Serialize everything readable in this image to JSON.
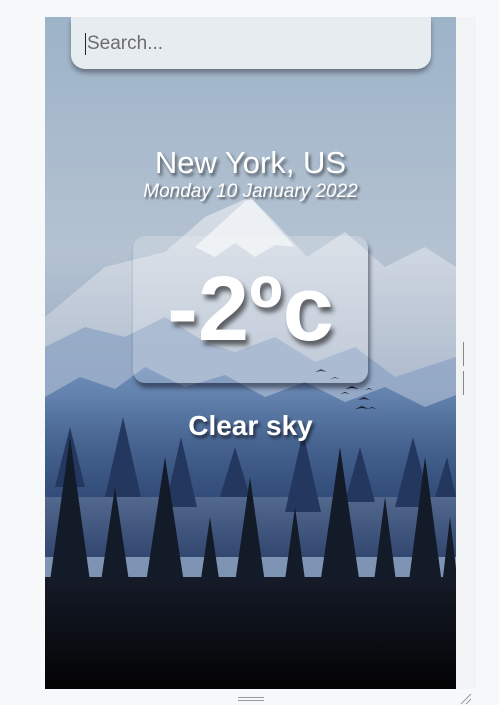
{
  "search": {
    "placeholder": "Search..."
  },
  "weather": {
    "location": "New York, US",
    "date": "Monday 10 January 2022",
    "temperature": "-2ºc",
    "condition": "Clear sky"
  },
  "icons": {
    "resize_horizontal": "resize-handle-horizontal-icon",
    "resize_vertical": "resize-handle-vertical-icon",
    "resize_corner": "resize-corner-icon"
  },
  "colors": {
    "sky_top": "#9fb5cb",
    "mountain_far": "#d6dbe4",
    "mountain_mid": "#5579a6",
    "forest": "#10141d",
    "panel": "#e7ecf0"
  }
}
